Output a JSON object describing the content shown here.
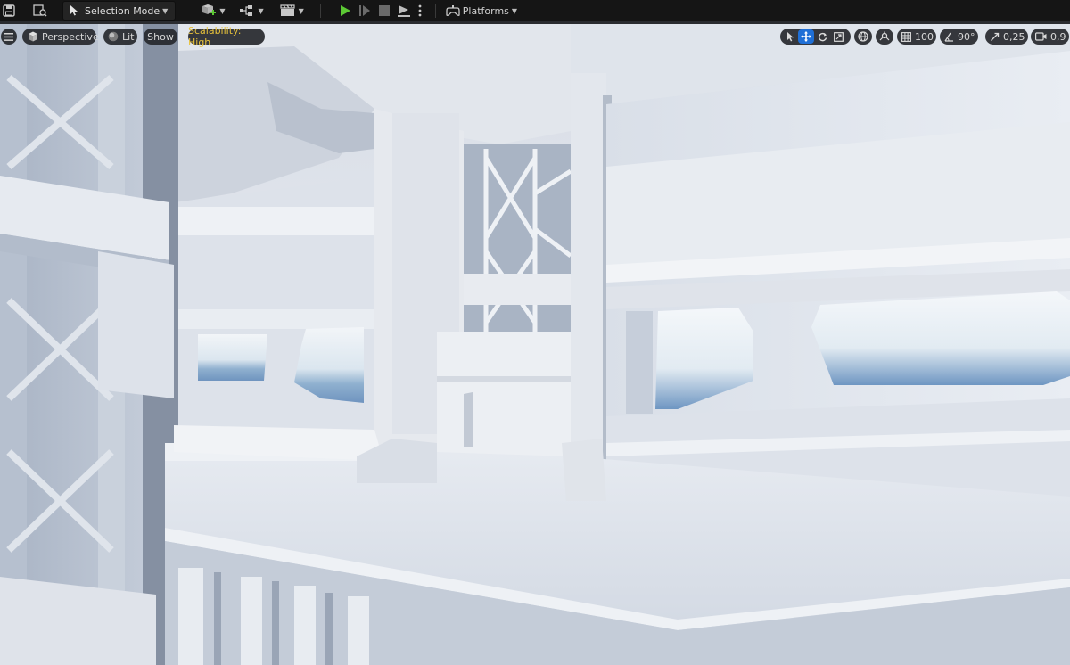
{
  "toolbar": {
    "selection_mode_label": "Selection Mode",
    "platforms_label": "Platforms"
  },
  "viewport": {
    "perspective_label": "Perspective",
    "lit_label": "Lit",
    "show_label": "Show",
    "scalability_label": "Scalability: High",
    "grid_snap_value": "100",
    "angle_snap_value": "90°",
    "scale_snap_value": "0,25",
    "camera_speed_value": "0,9"
  },
  "colors": {
    "accent_blue": "#1f6fd6",
    "scalability_text": "#e8c23a",
    "play_green": "#5cc934"
  }
}
